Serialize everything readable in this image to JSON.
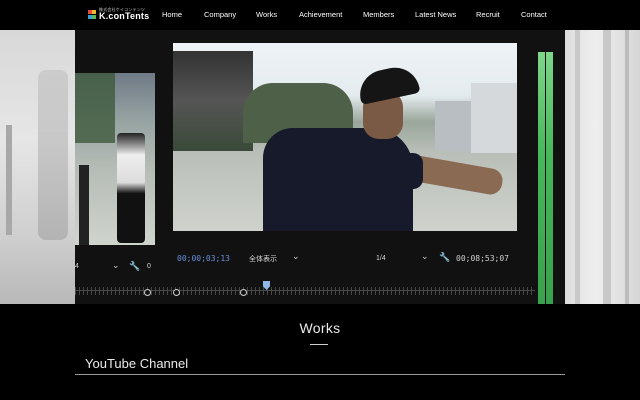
{
  "header": {
    "logo_sub": "株式会社ケイコンテンツ",
    "logo_main": "K.conTents",
    "brand_colors": [
      "#e94b3c",
      "#f2b632",
      "#3aa0d8",
      "#5cb85c"
    ],
    "nav": [
      {
        "label": "Home"
      },
      {
        "label": "Company"
      },
      {
        "label": "Works"
      },
      {
        "label": "Achievement"
      },
      {
        "label": "Members"
      },
      {
        "label": "Latest News"
      },
      {
        "label": "Recruit"
      },
      {
        "label": "Contact"
      }
    ]
  },
  "hero": {
    "editor": {
      "timecode_current": "00;00;03;13",
      "view_label": "全体表示",
      "fraction": "1/4",
      "timecode_total": "00;08;53;07",
      "left_fraction": "4",
      "left_value": "0",
      "accent_color": "#6a90d8",
      "meter_color": "#47b85b"
    }
  },
  "works": {
    "title": "Works",
    "youtube_heading": "YouTube Channel"
  }
}
